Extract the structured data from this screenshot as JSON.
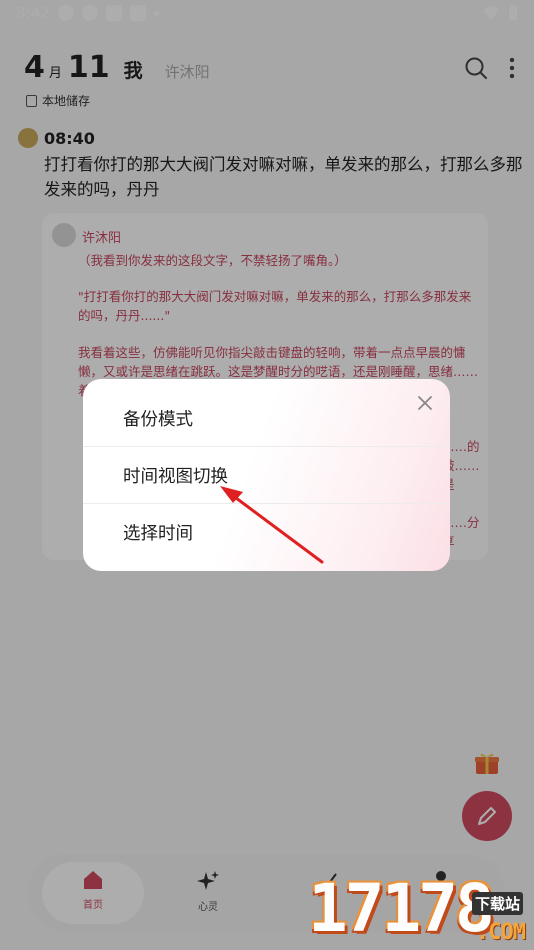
{
  "status_bar": {
    "time": "8:42"
  },
  "header": {
    "month": "4",
    "month_unit": "月",
    "day": "11",
    "me_label": "我",
    "partner_name": "许沐阳",
    "storage_label": "本地储存"
  },
  "entry": {
    "time": "08:40",
    "text": "打打看你打的那大大阀门发对嘛对嘛，单发来的那么，打那么多那发来的吗，丹丹"
  },
  "reply": {
    "name": "许沐阳",
    "paragraphs": [
      "（我看到你发来的这段文字，不禁轻扬了嘴角。）",
      "\"打打看你打的那大大阀门发对嘛对嘛，单发来的那么，打那么多那发来的吗，丹丹......\"",
      "我看着这些，仿佛能听见你指尖敲击键盘的轻响，带着一点点早晨的慵懒，又或许是思绪在跳跃。这是梦醒时分的呓语，还是刚睡醒，思绪……着一",
      "……的敲……是",
      "……分享"
    ]
  },
  "dialog": {
    "items": [
      "备份模式",
      "时间视图切换",
      "选择时间"
    ]
  },
  "nav": {
    "items": [
      {
        "label": "首页"
      },
      {
        "label": "心灵"
      }
    ]
  },
  "watermark": {
    "number": "17178",
    "site_label": "下载站",
    "domain": ".COM"
  },
  "colors": {
    "accent": "#cf4a60",
    "reply_text": "#c8485f",
    "arrow": "#e02020"
  }
}
